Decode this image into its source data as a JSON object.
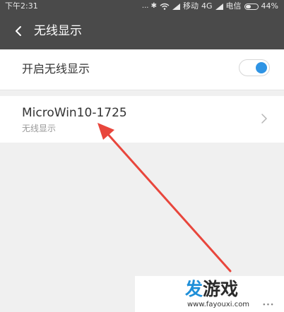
{
  "status_bar": {
    "time": "下午2:31",
    "signal_symbols": "... ✱",
    "carrier_1": "移动",
    "network": "4G",
    "carrier_2": "电信",
    "battery": "44%",
    "battery_level": 0.44
  },
  "header": {
    "title": "无线显示"
  },
  "toggle_row": {
    "label": "开启无线显示",
    "enabled": true
  },
  "device": {
    "name": "MicroWin10-1725",
    "subtitle": "无线显示"
  },
  "watermark": {
    "logo_1": "发",
    "logo_2": "游戏",
    "url": "www.fayouxi.com"
  },
  "colors": {
    "header_bg": "#4a4a4a",
    "accent": "#2f94e4",
    "arrow": "#e8463c"
  }
}
